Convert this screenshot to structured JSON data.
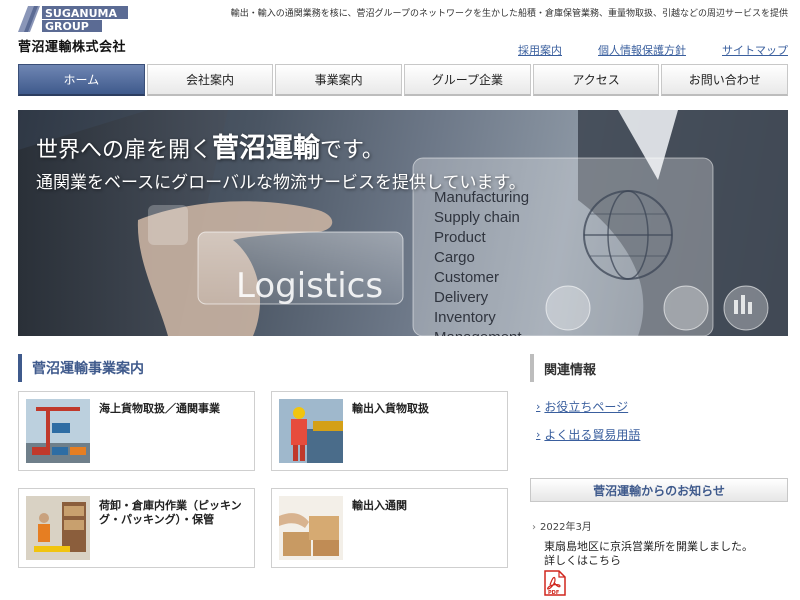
{
  "header": {
    "logo_line1": "SUGANUMA",
    "logo_line2": "GROUP",
    "company_name": "菅沼運輸株式会社",
    "tagline": "輸出・輸入の通関業務を核に、菅沼グループのネットワークを生かした船積・倉庫保管業務、重量物取扱、引越などの周辺サービスを提供",
    "utility_links": [
      "採用案内",
      "個人情報保護方針",
      "サイトマップ"
    ]
  },
  "nav": {
    "items": [
      "ホーム",
      "会社案内",
      "事業案内",
      "グループ企業",
      "アクセス",
      "お問い合わせ"
    ],
    "active_index": 0
  },
  "hero": {
    "title_prefix": "世界への扉を開く",
    "title_emphasis": "菅沼運輸",
    "title_suffix": "です。",
    "subtitle": "通関業をベースにグローバルな物流サービスを提供しています。",
    "logistics_word": "Logistics",
    "keywords": [
      "Manufacturing",
      "Supply chain",
      "Product",
      "Cargo",
      "Customer",
      "Delivery",
      "Inventory",
      "Management"
    ]
  },
  "business": {
    "heading": "菅沼運輸事業案内",
    "cards": [
      {
        "label": "海上貨物取扱／通関事業"
      },
      {
        "label": "輸出入貨物取扱"
      },
      {
        "label": "荷卸・倉庫内作業（ピッキング・パッキング）・保管"
      },
      {
        "label": "輸出入通関"
      }
    ]
  },
  "sidebar": {
    "heading": "関連情報",
    "links": [
      "お役立ちページ",
      "よく出る貿易用語"
    ],
    "news_heading": "菅沼運輸からのお知らせ",
    "news_date": "2022年3月",
    "news_line1": "東扇島地区に京浜営業所を開業しました。",
    "news_line2": "詳しくはこちら",
    "pdf_label": "PDF"
  },
  "colors": {
    "brand_blue": "#3f5a8c",
    "link_blue": "#3a5f9e",
    "pdf_red": "#d0261d"
  }
}
